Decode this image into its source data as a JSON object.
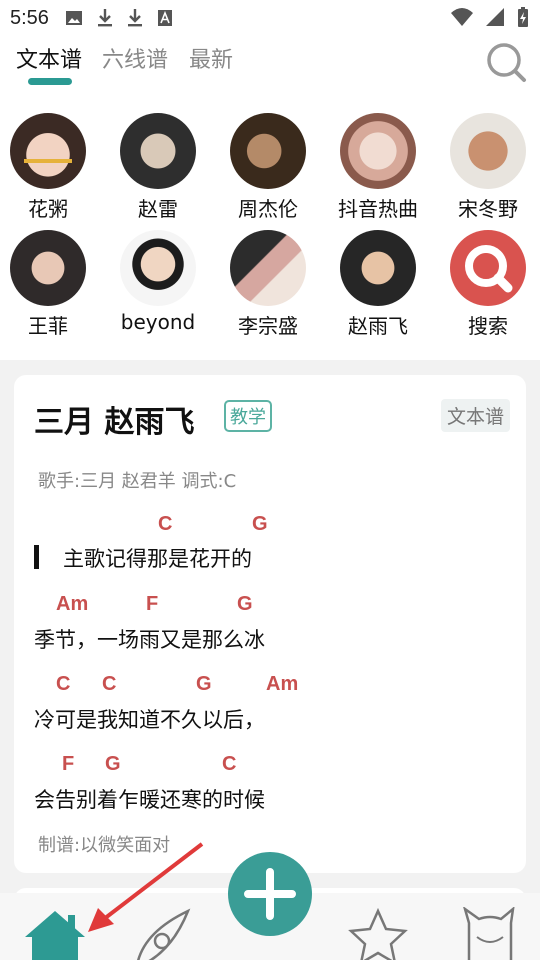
{
  "status_bar": {
    "time": "5:56"
  },
  "tabs": [
    {
      "label": "文本谱",
      "active": true
    },
    {
      "label": "六线谱",
      "active": false
    },
    {
      "label": "最新",
      "active": false
    }
  ],
  "artists": [
    {
      "name": "花粥"
    },
    {
      "name": "赵雷"
    },
    {
      "name": "周杰伦"
    },
    {
      "name": "抖音热曲"
    },
    {
      "name": "宋冬野"
    },
    {
      "name": "王菲"
    },
    {
      "name": "beyond"
    },
    {
      "name": "李宗盛"
    },
    {
      "name": "赵雨飞"
    },
    {
      "name": "搜索"
    }
  ],
  "song_card": {
    "title": "三月 赵雨飞",
    "badge_teach": "教学",
    "badge_type": "文本谱",
    "meta": "歌手:三月 赵君羊  调式:C",
    "chords": [
      "C",
      "G",
      "Am",
      "F",
      "G",
      "C",
      "C",
      "G",
      "Am",
      "F",
      "G",
      "C"
    ],
    "lyrics": [
      "主歌记得那是花开的",
      "季节，一场雨又是那么冰",
      "冷可是我知道不久以后，",
      "会告别着乍暖还寒的时候"
    ],
    "credit": "制谱:以微笑面对"
  },
  "colors": {
    "accent": "#2b9a93",
    "chord": "#c8504f",
    "search_red": "#d9534f"
  }
}
